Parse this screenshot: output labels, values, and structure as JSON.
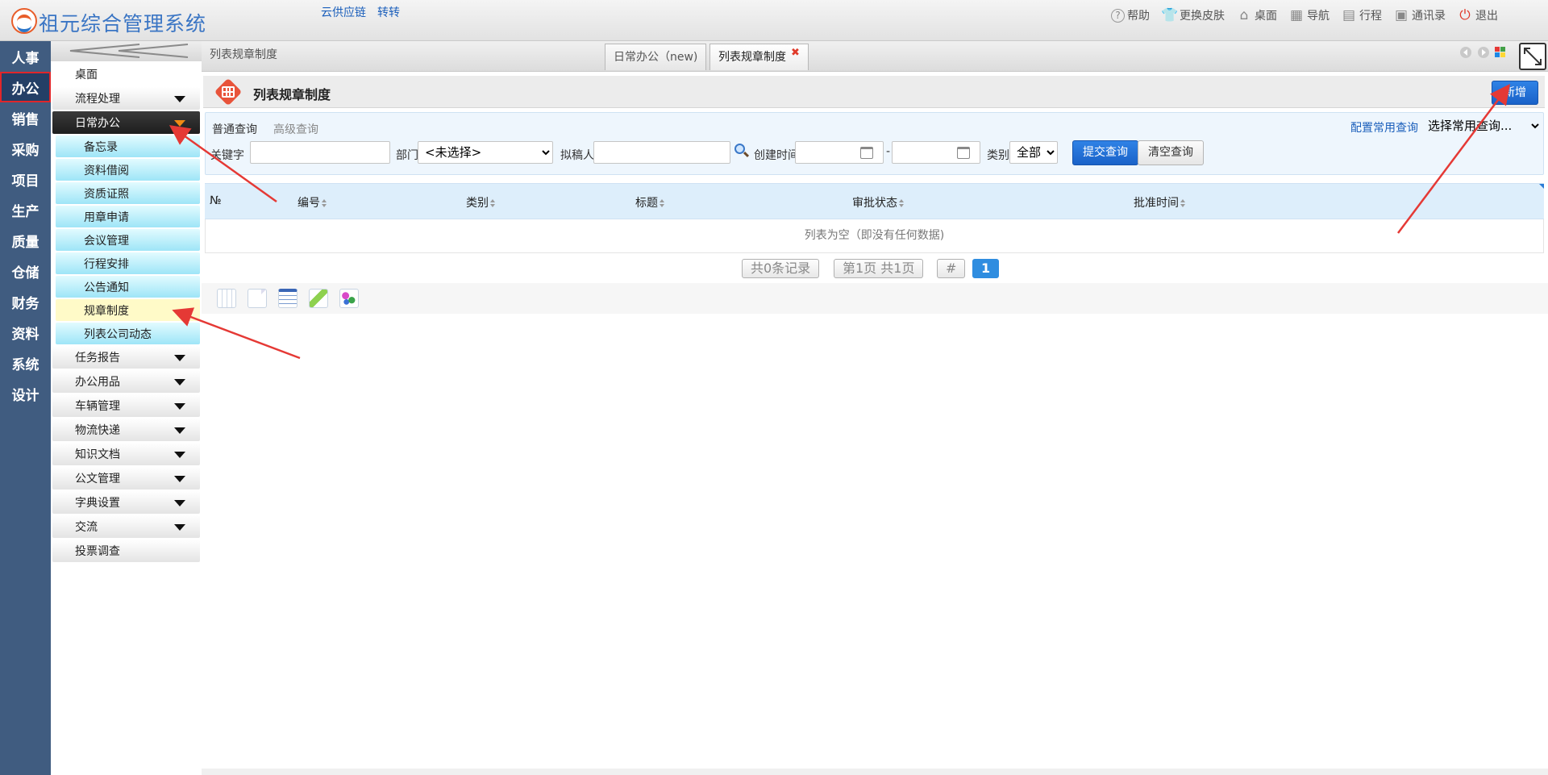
{
  "app": {
    "title": "祖元综合管理系统",
    "top_links": [
      "云供应链",
      "转转"
    ]
  },
  "top_menu": [
    {
      "label": "帮助",
      "icon": "help-icon"
    },
    {
      "label": "更换皮肤",
      "icon": "shirt-icon"
    },
    {
      "label": "桌面",
      "icon": "home-icon"
    },
    {
      "label": "导航",
      "icon": "grid-icon"
    },
    {
      "label": "行程",
      "icon": "calendar-icon"
    },
    {
      "label": "通讯录",
      "icon": "contacts-icon"
    },
    {
      "label": "退出",
      "icon": "power-icon"
    }
  ],
  "left_nav": [
    "人事",
    "办公",
    "销售",
    "采购",
    "项目",
    "生产",
    "质量",
    "仓储",
    "财务",
    "资料",
    "系统",
    "设计"
  ],
  "left_nav_active": "办公",
  "submenu": {
    "items": [
      {
        "label": "桌面"
      },
      {
        "label": "流程处理"
      },
      {
        "label": "日常办公"
      },
      {
        "label": "任务报告"
      },
      {
        "label": "办公用品"
      },
      {
        "label": "车辆管理"
      },
      {
        "label": "物流快递"
      },
      {
        "label": "知识文档"
      },
      {
        "label": "公文管理"
      },
      {
        "label": "字典设置"
      },
      {
        "label": "交流"
      },
      {
        "label": "投票调查"
      }
    ],
    "daily_children": [
      "备忘录",
      "资料借阅",
      "资质证照",
      "用章申请",
      "会议管理",
      "行程安排",
      "公告通知",
      "规章制度",
      "列表公司动态"
    ],
    "current_child": "规章制度"
  },
  "tabs": {
    "breadcrumb": "列表规章制度",
    "items": [
      {
        "label": "日常办公（new)"
      },
      {
        "label": "列表规章制度"
      }
    ],
    "close_symbol": "✖"
  },
  "page": {
    "title": "列表规章制度",
    "new_button": "新增"
  },
  "search": {
    "tab_normal": "普通查询",
    "tab_advanced": "高级查询",
    "config_link": "配置常用查询",
    "quick_select": "选择常用查询...",
    "keyword_label": "关键字",
    "keyword_value": "",
    "dept_label": "部门",
    "dept_value": "<未选择>",
    "drafter_label": "拟稿人",
    "drafter_value": "",
    "created_label": "创建时间",
    "date_separator": "-",
    "category_label": "类别",
    "category_value": "全部",
    "submit": "提交查询",
    "clear": "清空查询"
  },
  "grid": {
    "columns": [
      "№",
      "编号",
      "类别",
      "标题",
      "审批状态",
      "批准时间"
    ],
    "empty_text": "列表为空（即没有任何数据)"
  },
  "pager": {
    "total": "共0条记录",
    "pages": "第1页 共1页",
    "hash": "#",
    "current": "1"
  },
  "colors": {
    "accent_blue": "#1a62c8",
    "nav_bg": "#405c80",
    "annotation_red": "#e53935"
  }
}
